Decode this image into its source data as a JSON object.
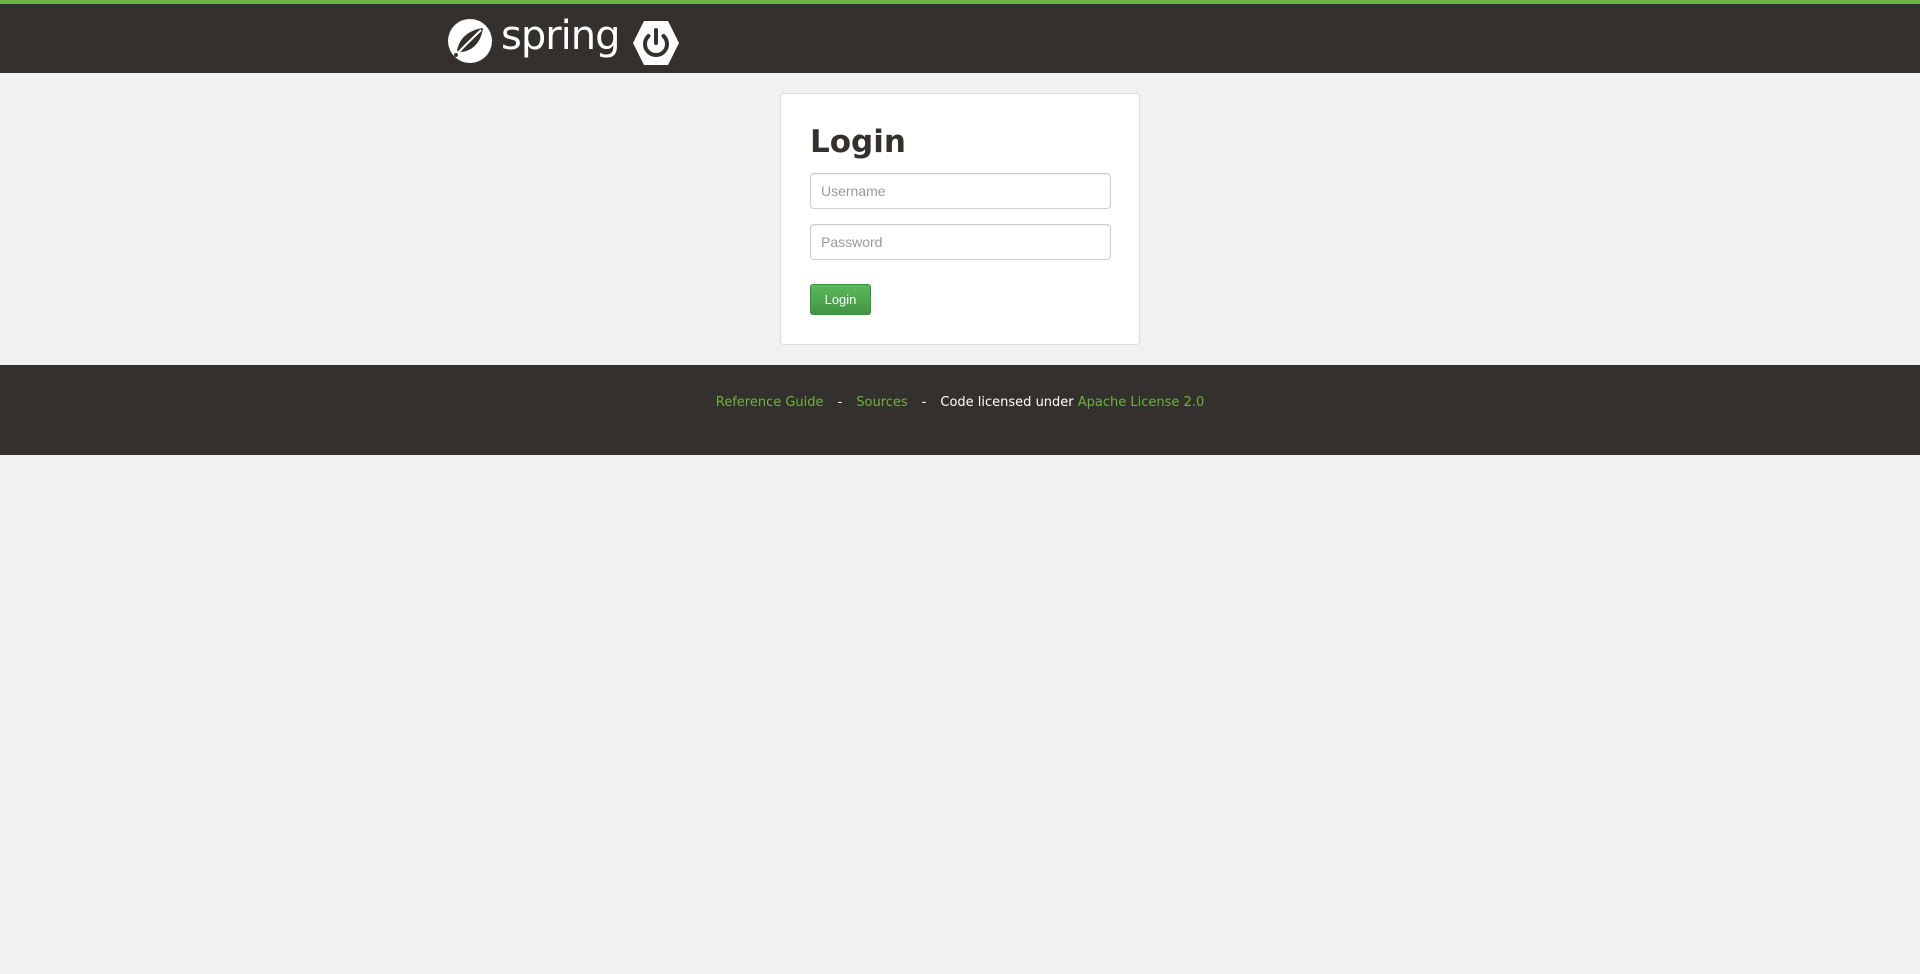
{
  "header": {
    "brand_text": "spring",
    "accent_color": "#6db33f",
    "bar_color": "#34302d",
    "logo_icon": "spring-leaf-icon",
    "boot_icon": "spring-boot-power-icon"
  },
  "login": {
    "title": "Login",
    "username_placeholder": "Username",
    "password_placeholder": "Password",
    "username_value": "",
    "password_value": "",
    "submit_label": "Login"
  },
  "footer": {
    "reference_guide": "Reference Guide",
    "separator": "-",
    "sources": "Sources",
    "license_prefix": "Code licensed under",
    "license_link": "Apache License 2.0"
  }
}
